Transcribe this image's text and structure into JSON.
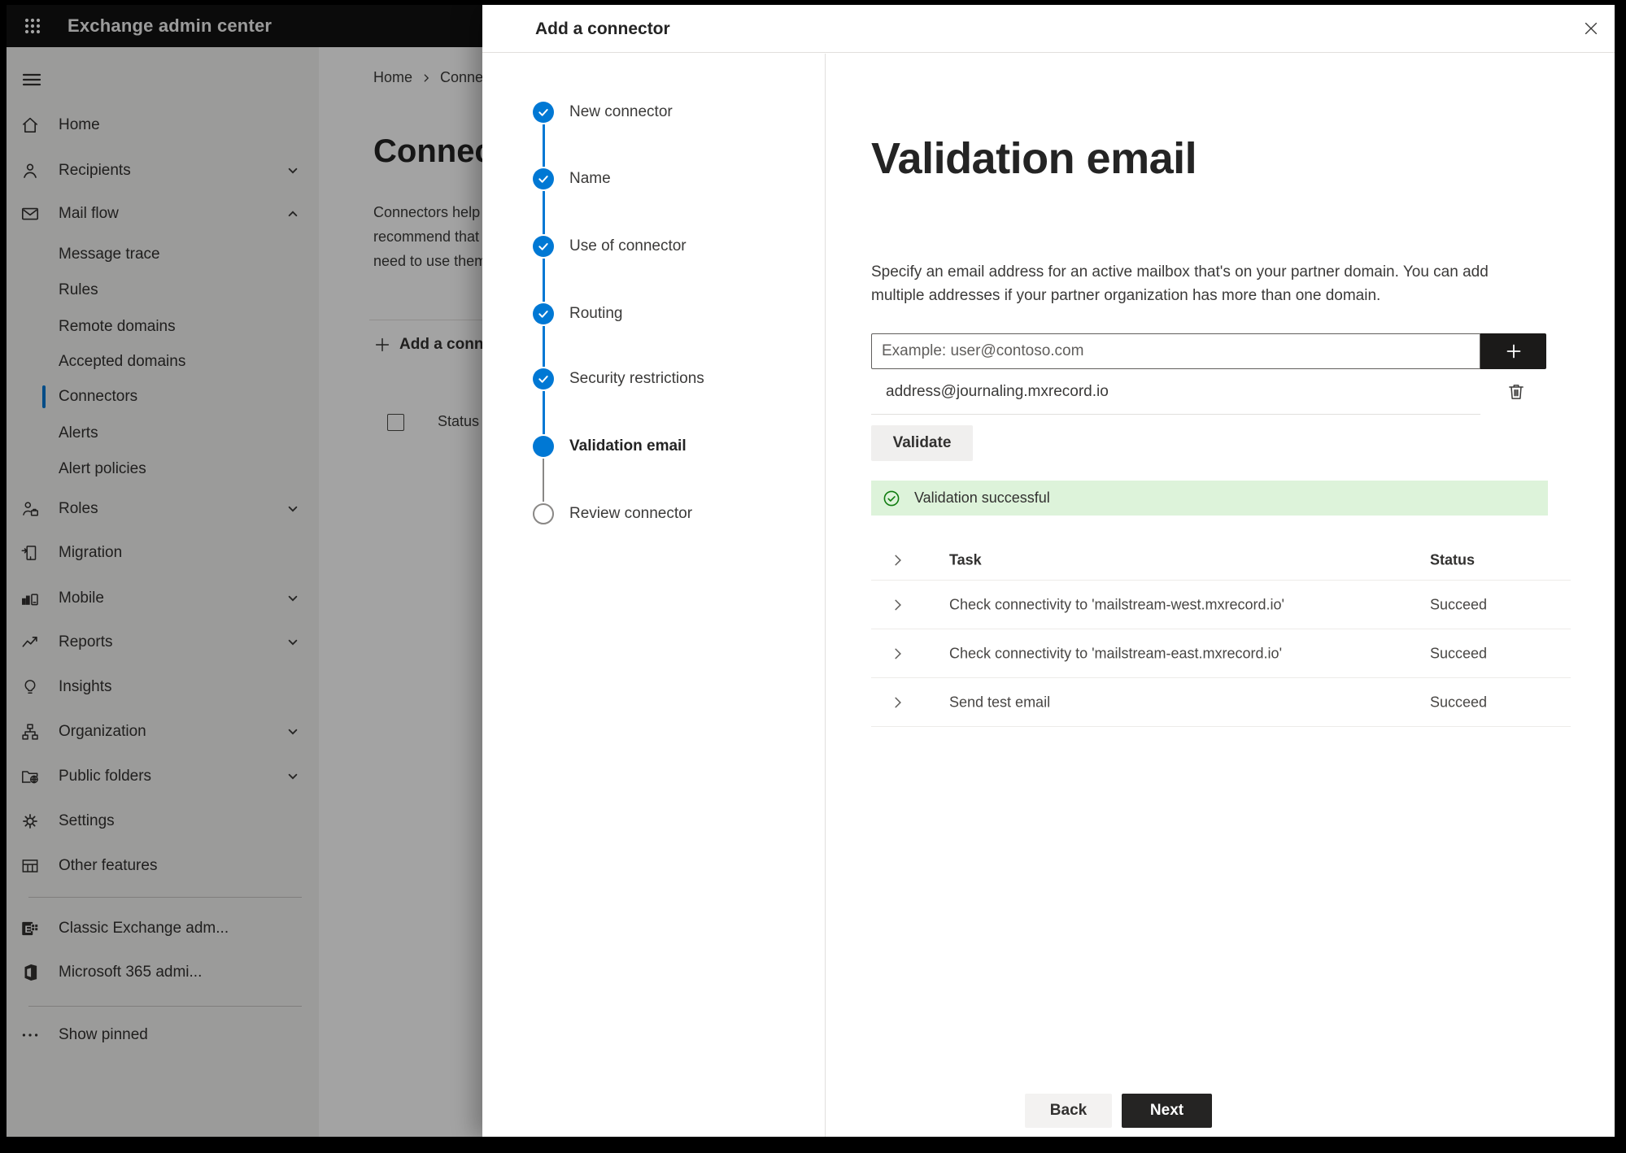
{
  "app": {
    "title": "Exchange admin center"
  },
  "sidebar": {
    "items": [
      {
        "label": "Home",
        "icon": "home-icon"
      },
      {
        "label": "Recipients",
        "icon": "person-icon",
        "chevron": "down"
      },
      {
        "label": "Mail flow",
        "icon": "mail-icon",
        "chevron": "up",
        "expanded": true
      },
      {
        "label": "Message trace",
        "sub": true
      },
      {
        "label": "Rules",
        "sub": true
      },
      {
        "label": "Remote domains",
        "sub": true
      },
      {
        "label": "Accepted domains",
        "sub": true
      },
      {
        "label": "Connectors",
        "sub": true,
        "selected": true
      },
      {
        "label": "Alerts",
        "sub": true
      },
      {
        "label": "Alert policies",
        "sub": true
      },
      {
        "label": "Roles",
        "icon": "roles-icon",
        "chevron": "down"
      },
      {
        "label": "Migration",
        "icon": "migration-icon"
      },
      {
        "label": "Mobile",
        "icon": "mobile-icon",
        "chevron": "down"
      },
      {
        "label": "Reports",
        "icon": "reports-icon",
        "chevron": "down"
      },
      {
        "label": "Insights",
        "icon": "insights-icon"
      },
      {
        "label": "Organization",
        "icon": "organization-icon",
        "chevron": "down"
      },
      {
        "label": "Public folders",
        "icon": "public-folders-icon",
        "chevron": "down"
      },
      {
        "label": "Settings",
        "icon": "settings-icon"
      },
      {
        "label": "Other features",
        "icon": "other-features-icon"
      },
      {
        "label": "Classic Exchange adm...",
        "icon": "classic-exchange-icon"
      },
      {
        "label": "Microsoft 365 admi...",
        "icon": "microsoft-365-icon"
      },
      {
        "label": "Show pinned",
        "icon": "ellipsis-icon"
      }
    ]
  },
  "background": {
    "breadcrumb": {
      "home": "Home",
      "current": "Connectors"
    },
    "page_title": "Connectors",
    "description_lines": [
      "Connectors help",
      "recommend that",
      "need to use them"
    ],
    "add_button_label": "Add a connector",
    "status_column": "Status"
  },
  "panel": {
    "title": "Add a connector",
    "steps": [
      {
        "label": "New connector",
        "state": "done"
      },
      {
        "label": "Name",
        "state": "done"
      },
      {
        "label": "Use of connector",
        "state": "done"
      },
      {
        "label": "Routing",
        "state": "done"
      },
      {
        "label": "Security restrictions",
        "state": "done"
      },
      {
        "label": "Validation email",
        "state": "current"
      },
      {
        "label": "Review connector",
        "state": "pending"
      }
    ],
    "content": {
      "heading": "Validation email",
      "description_lines": [
        "Specify an email address for an active mailbox that's on your partner domain. You can add",
        "multiple addresses if your partner organization has more than one domain."
      ],
      "email_input_placeholder": "Example: user@contoso.com",
      "added_address": "address@journaling.mxrecord.io",
      "validate_button": "Validate",
      "banner_text": "Validation successful",
      "table": {
        "columns": {
          "task": "Task",
          "status": "Status"
        },
        "rows": [
          {
            "task": "Check connectivity to 'mailstream-west.mxrecord.io'",
            "status": "Succeed"
          },
          {
            "task": "Check connectivity to 'mailstream-east.mxrecord.io'",
            "status": "Succeed"
          },
          {
            "task": "Send test email",
            "status": "Succeed"
          }
        ]
      }
    },
    "footer": {
      "back_label": "Back",
      "next_label": "Next"
    }
  },
  "colors": {
    "accent": "#0078d4",
    "success_banner_bg": "#ddf3da",
    "success_icon": "#107c10",
    "topbar_bg": "#121212",
    "sidebar_bg": "#f3f2f1"
  }
}
